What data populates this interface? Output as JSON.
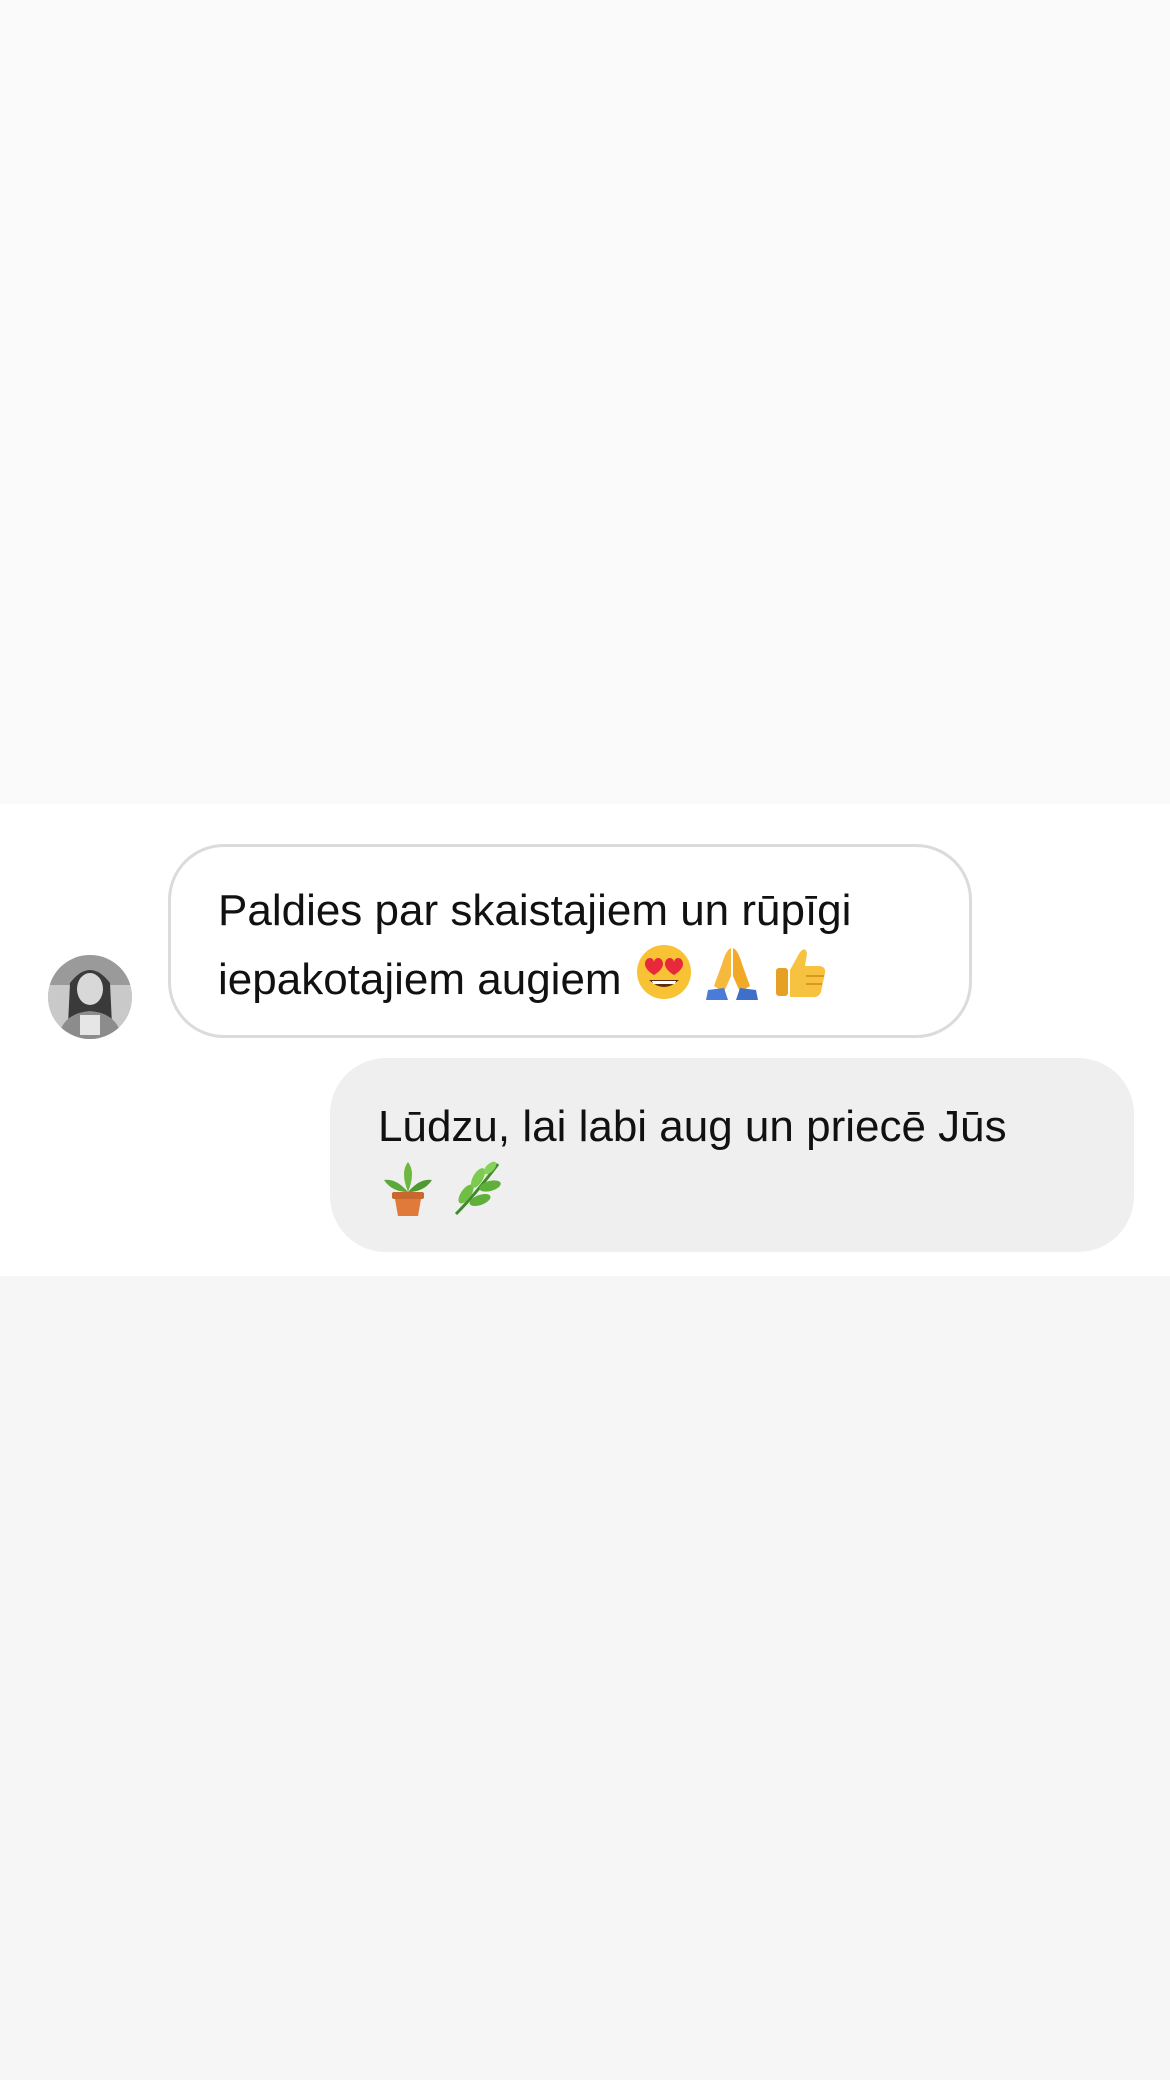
{
  "conversation": {
    "messages": [
      {
        "direction": "incoming",
        "text": "Paldies par skaistajiem un rūpīgi iepakotajiem augiem",
        "emojis": [
          "heart-eyes-emoji",
          "folded-hands-emoji",
          "thumbs-up-emoji"
        ]
      },
      {
        "direction": "outgoing",
        "text": "Lūdzu, lai labi aug un priecē Jūs",
        "emojis": [
          "potted-plant-emoji",
          "herb-emoji"
        ]
      }
    ]
  },
  "colors": {
    "top_background": "#fafafa",
    "chat_background": "#ffffff",
    "bottom_background": "#f6f6f6",
    "incoming_bubble_border": "#dbdbdb",
    "outgoing_bubble_background": "#efefef",
    "text": "#111111"
  }
}
